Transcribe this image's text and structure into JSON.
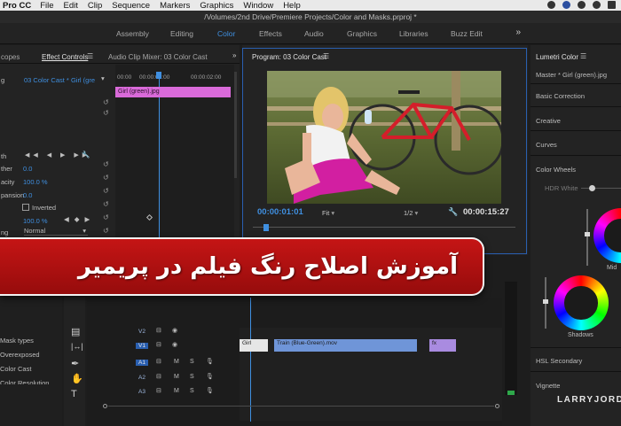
{
  "menubar": {
    "app_name": "Pro CC",
    "items": [
      "File",
      "Edit",
      "Clip",
      "Sequence",
      "Markers",
      "Graphics",
      "Window",
      "Help"
    ]
  },
  "window": {
    "title": "/Volumes/2nd Drive/Premiere Projects/Color and Masks.prproj *"
  },
  "workspaces": {
    "items": [
      "Assembly",
      "Editing",
      "Color",
      "Effects",
      "Audio",
      "Graphics",
      "Libraries",
      "Buzz Edit"
    ],
    "active": "Color",
    "more": "»"
  },
  "left_panel": {
    "tabs": {
      "scopes": "copes",
      "effect_controls": "Effect Controls",
      "audio_mixer": "Audio Clip Mixer: 03 Color Cast",
      "more": "»"
    },
    "source_prefix": "g",
    "clip_selector": "03 Color Cast * Girl (gre",
    "timecodes": [
      "00:00",
      "00:00:01:00",
      "00:00:02:00"
    ],
    "clip_name": "Girl (green).jpg",
    "rows": [
      {
        "label": "th"
      },
      {
        "label": "ther",
        "value": "0.0"
      },
      {
        "label": "acity",
        "value": "100.0 %"
      },
      {
        "label": "pansion",
        "value": "0.0"
      },
      {
        "label": "",
        "checkbox": "Inverted"
      },
      {
        "label": "",
        "value": "100.0 %"
      },
      {
        "label": "ng",
        "dropdown": "Normal"
      }
    ]
  },
  "program_monitor": {
    "title": "Program: 03 Color Cast",
    "timecode_current": "00:00:01:01",
    "fit": "Fit",
    "resolution": "1/2",
    "timecode_duration": "00:00:15:27"
  },
  "lumetri": {
    "title": "Lumetri Color",
    "master": "Master * Girl (green).jpg",
    "sections": [
      "Basic Correction",
      "Creative",
      "Curves",
      "Color Wheels"
    ],
    "hdr_white": "HDR White",
    "mid_label": "Mid",
    "shadows_label": "Shadows",
    "hsl": "HSL Secondary",
    "vignette": "Vignette"
  },
  "timeline": {
    "tracks": [
      {
        "name": "V2",
        "targeted": false
      },
      {
        "name": "V1",
        "targeted": true
      },
      {
        "name": "A1",
        "targeted": true
      },
      {
        "name": "A2",
        "targeted": false
      },
      {
        "name": "A3",
        "targeted": false
      }
    ],
    "clips": [
      "Girl",
      "Train (Blue-Green).mov",
      "fx"
    ]
  },
  "project_panel": {
    "items": [
      "Mask types",
      "Overexposed",
      "Color Cast",
      "Color Resolution"
    ]
  },
  "banner": {
    "text": "آموزش اصلاح رنگ فیلم در پریمیر"
  },
  "watermark": "LARRYJORDA",
  "colors": {
    "accent": "#3f8fe0",
    "banner": "#c51515",
    "clip_pink": "#d96ad9",
    "clip_blue": "#6f95d8",
    "clip_purple": "#a98be0"
  }
}
